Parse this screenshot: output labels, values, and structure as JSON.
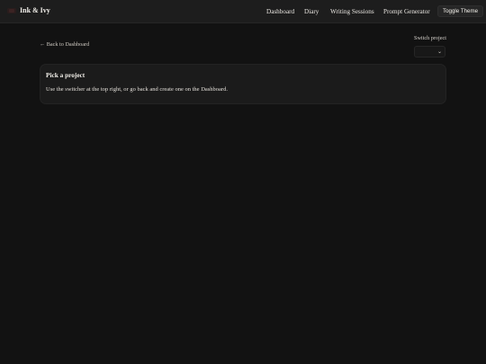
{
  "header": {
    "brand": "Ink & Ivy",
    "nav": [
      {
        "label": "Dashboard"
      },
      {
        "label": "Diary"
      },
      {
        "label": "Writing Sessions"
      },
      {
        "label": "Prompt Generator"
      }
    ],
    "toggle_theme": "Toggle Theme"
  },
  "page": {
    "back_link": "← Back to Dashboard",
    "switch_project_label": "Switch project",
    "switch_project_value": "",
    "card": {
      "title": "Pick a project",
      "text": "Use the switcher at the top right, or go back and create one on the Dashboard."
    }
  },
  "colors": {
    "background": "#121212",
    "topbar": "#1d1d1d",
    "card": "#1b1b1b",
    "text": "#e8e6e3"
  }
}
